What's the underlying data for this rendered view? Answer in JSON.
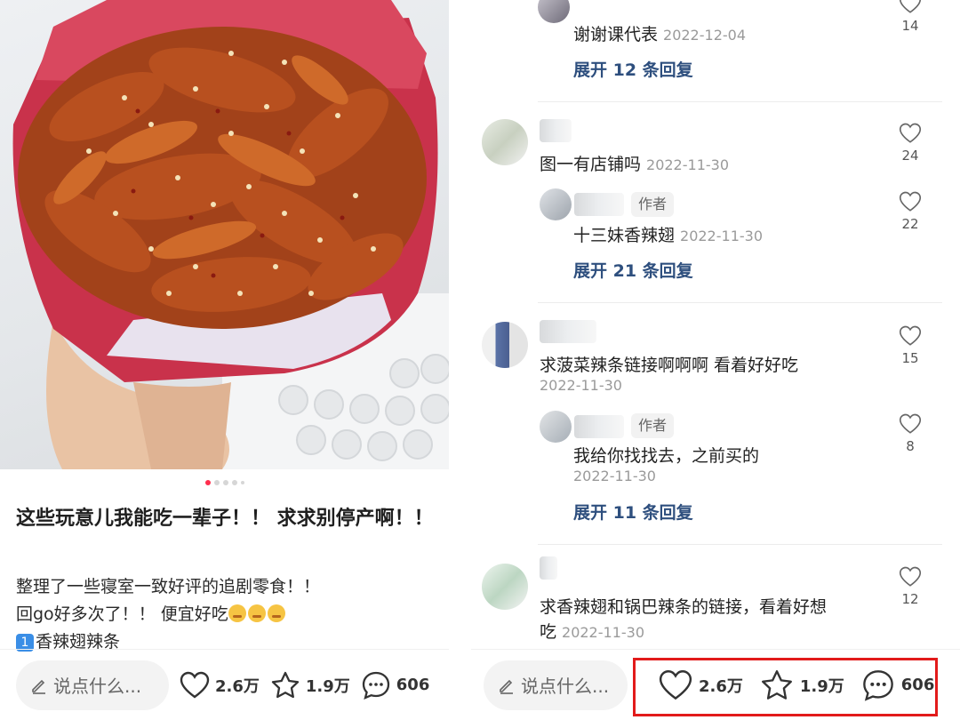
{
  "post": {
    "title": "这些玩意儿我能吃一辈子！！ 求求别停产啊！！",
    "body_line1": "整理了一些寝室一致好评的追剧零食！！",
    "body_line2": "回go好多次了！！ 便宜好吃",
    "body_line3_badge": "1",
    "body_line3": "香辣翅辣条",
    "emoji": "drooling-face-emoji",
    "image_count": 5,
    "active_image": 1
  },
  "bottom_bar": {
    "say_placeholder": "说点什么...",
    "likes": "2.6万",
    "collects": "1.9万",
    "comments": "606"
  },
  "comments": {
    "c0": {
      "text": "谢谢课代表",
      "date": "2022-12-04",
      "likes": "14",
      "expand": "展开 12 条回复"
    },
    "c1": {
      "text": "图一有店铺吗",
      "date": "2022-11-30",
      "likes": "24",
      "reply": {
        "tag": "作者",
        "text": "十三妹香辣翅",
        "date": "2022-11-30",
        "likes": "22"
      },
      "expand": "展开 21 条回复"
    },
    "c2": {
      "text": "求菠菜辣条链接啊啊啊 看着好好吃",
      "date": "2022-11-30",
      "likes": "15",
      "reply": {
        "tag": "作者",
        "text": "我给你找找去，之前买的",
        "date": "2022-11-30",
        "likes": "8"
      },
      "expand": "展开 11 条回复"
    },
    "c3": {
      "text_line1": "求香辣翅和锅巴辣条的链接，看着好想",
      "text_line2": "吃",
      "date": "2022-11-30",
      "likes": "12"
    }
  },
  "colors": {
    "accent": "#ff2e4d",
    "expand_link": "#2e4f7e",
    "highlight": "#e21b1b"
  }
}
